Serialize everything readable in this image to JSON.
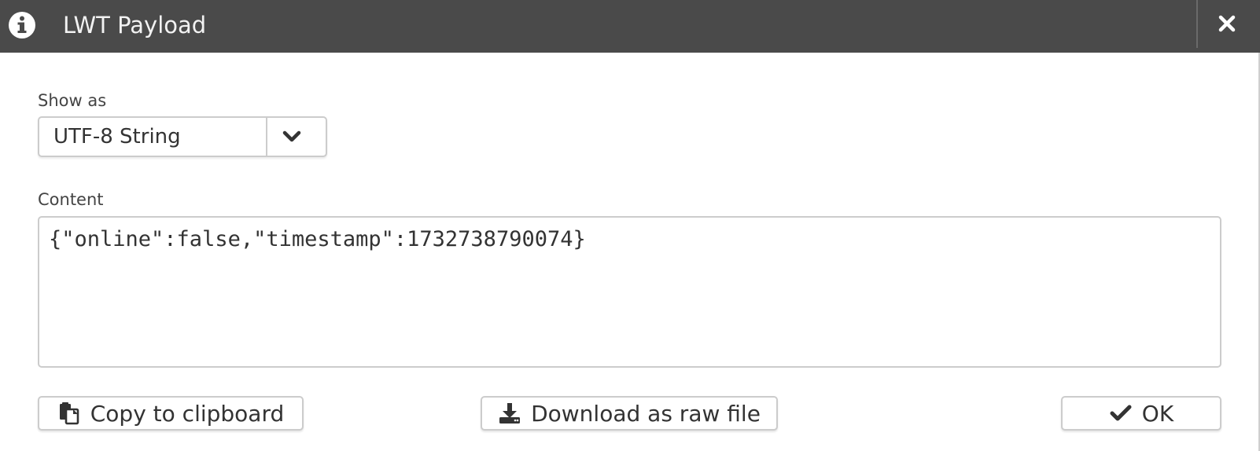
{
  "dialog": {
    "title": "LWT Payload"
  },
  "show_as": {
    "label": "Show as",
    "selected": "UTF-8 String"
  },
  "content": {
    "label": "Content",
    "value": "{\"online\":false,\"timestamp\":1732738790074}"
  },
  "actions": {
    "copy_label": "Copy to clipboard",
    "download_label": "Download as raw file",
    "ok_label": "OK"
  },
  "icons": {
    "title": "info-icon",
    "close": "close-icon",
    "select": "chevron-down-icon",
    "copy": "clipboard-icon",
    "download": "download-icon",
    "ok": "check-icon"
  },
  "colors": {
    "titlebar": "#4a4a4a",
    "border": "#cccccc"
  }
}
